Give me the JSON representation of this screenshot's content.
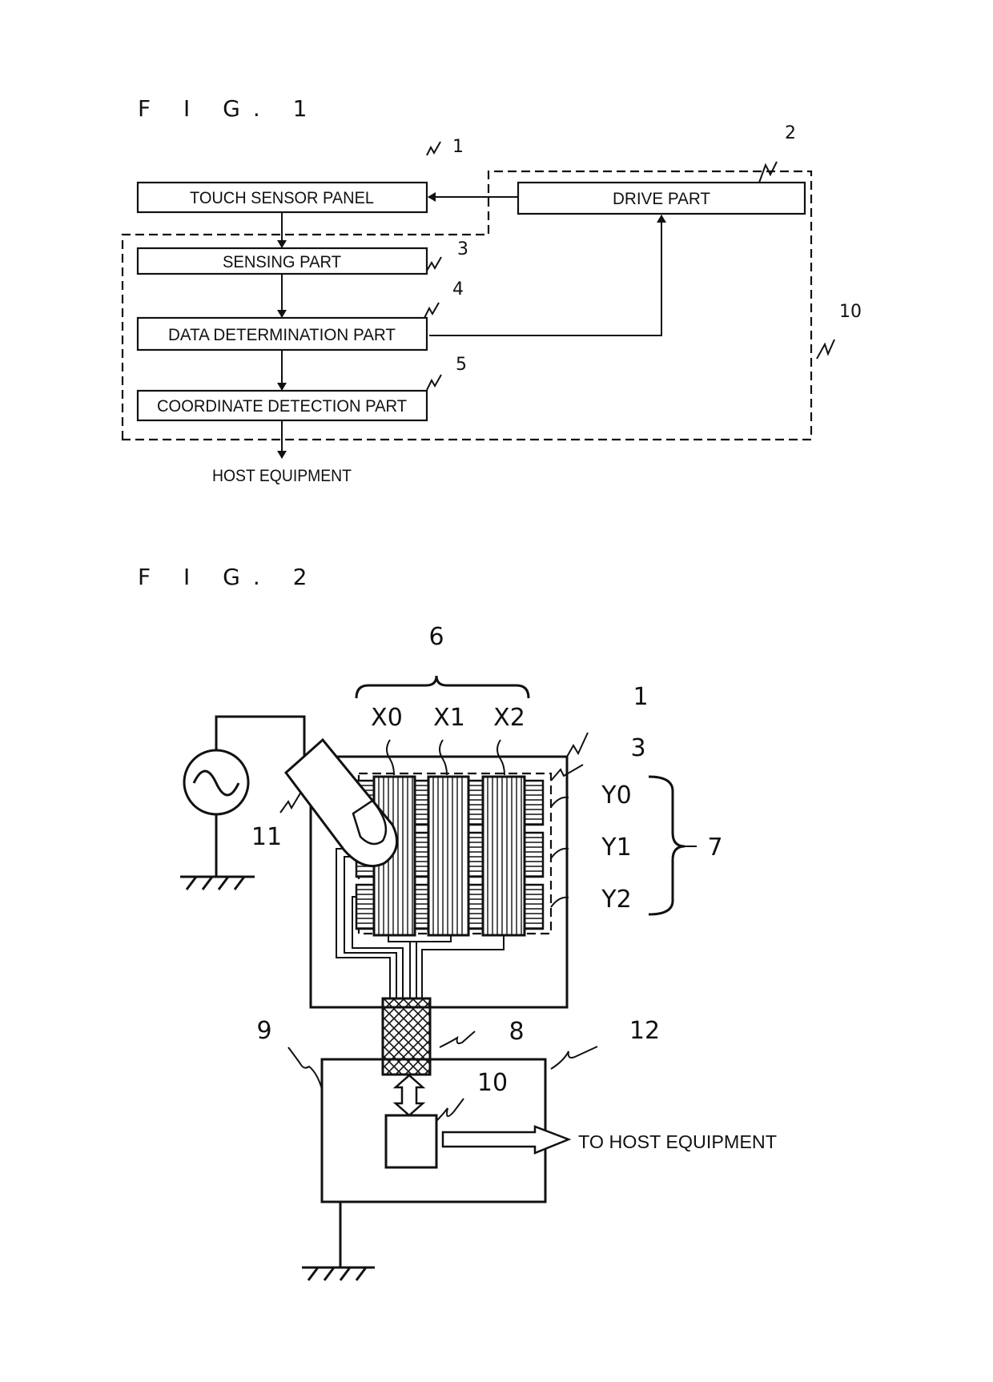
{
  "fig1": {
    "title": "F I G.  1",
    "blocks": {
      "touch_sensor_panel": {
        "label": "TOUCH SENSOR PANEL",
        "ref": "1"
      },
      "drive_part": {
        "label": "DRIVE PART",
        "ref": "2"
      },
      "sensing_part": {
        "label": "SENSING PART",
        "ref": "3"
      },
      "data_determination_part": {
        "label": "DATA DETERMINATION PART",
        "ref": "4"
      },
      "coordinate_detection_part": {
        "label": "COORDINATE DETECTION PART",
        "ref": "5"
      }
    },
    "controller_ref": "10",
    "output_label": "HOST EQUIPMENT"
  },
  "fig2": {
    "title": "F I G.  2",
    "x_group_ref": "6",
    "x_electrodes": [
      "X0",
      "X1",
      "X2"
    ],
    "y_electrodes": [
      "Y0",
      "Y1",
      "Y2"
    ],
    "y_group_ref": "7",
    "panel_ref": "1",
    "sensing_region_ref": "3",
    "connector_ref": "8",
    "board_ref": "9",
    "controller_ref": "10",
    "finger_ref": "11",
    "device_ref": "12",
    "output_label": "TO HOST EQUIPMENT"
  }
}
